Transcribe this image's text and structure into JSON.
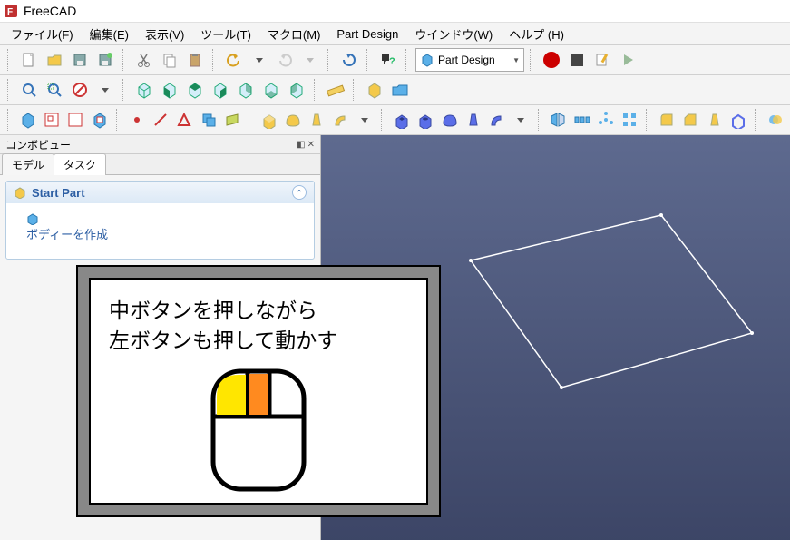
{
  "title": "FreeCAD",
  "menu": {
    "file": "ファイル(F)",
    "edit": "編集(E)",
    "view": "表示(V)",
    "tools": "ツール(T)",
    "macro": "マクロ(M)",
    "partdesign": "Part Design",
    "window": "ウインドウ(W)",
    "help": "ヘルプ (H)"
  },
  "workbench": {
    "label": "Part Design"
  },
  "dock": {
    "title": "コンボビュー",
    "tab_model": "モデル",
    "tab_task": "タスク",
    "task_header": "Start Part",
    "task_link": "ボディーを作成"
  },
  "overlay": {
    "line1": "中ボタンを押しながら",
    "line2": "左ボタンも押して動かす"
  },
  "colors": {
    "accent": "#2d5fa4"
  }
}
